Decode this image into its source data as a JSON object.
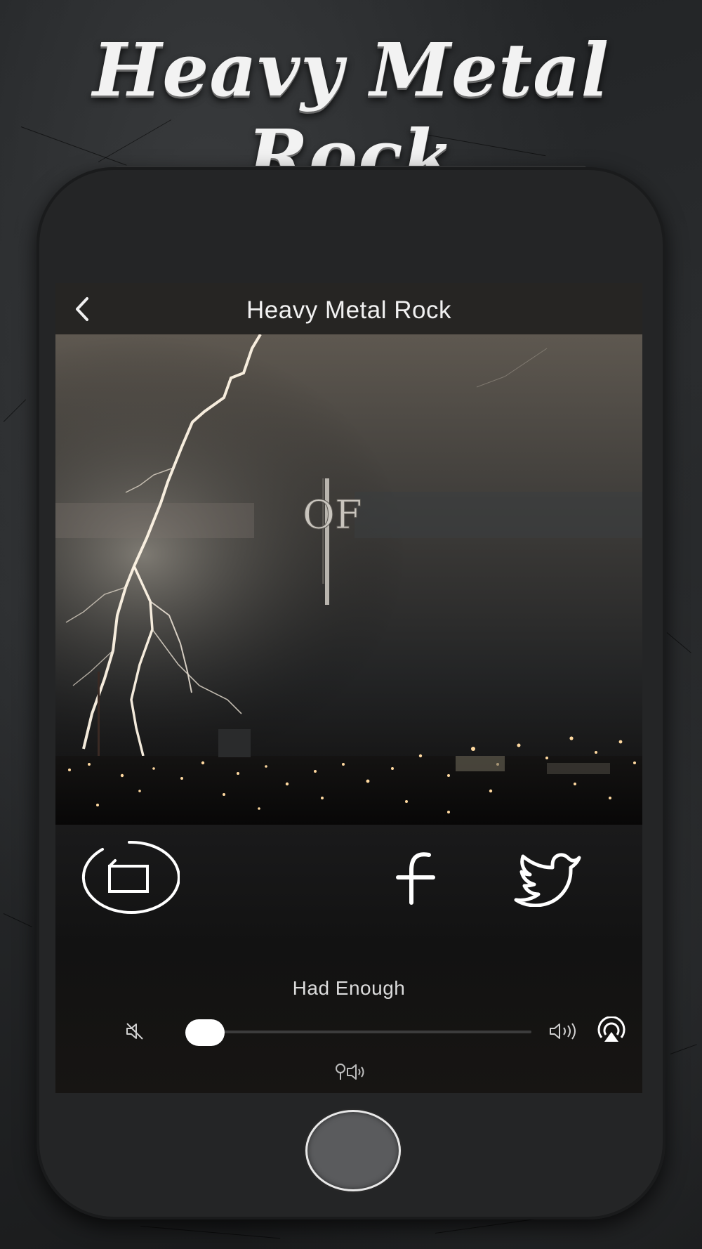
{
  "promo": {
    "title": "Heavy Metal Rock"
  },
  "app": {
    "nav_title": "Heavy Metal Rock",
    "artwork_text": "OF",
    "song_title": "Had Enough",
    "volume_fraction": 0.05
  },
  "icons": {
    "back": "chevron-left-icon",
    "cast": "screen-mirror-icon",
    "facebook": "facebook-icon",
    "twitter": "twitter-icon",
    "mute": "mute-icon",
    "volume": "volume-icon",
    "airplay": "airplay-icon",
    "speaker": "speaker-output-icon"
  },
  "colors": {
    "accent": "#ffffff",
    "nav_bar": "#262523",
    "phone_body": "#242526"
  }
}
